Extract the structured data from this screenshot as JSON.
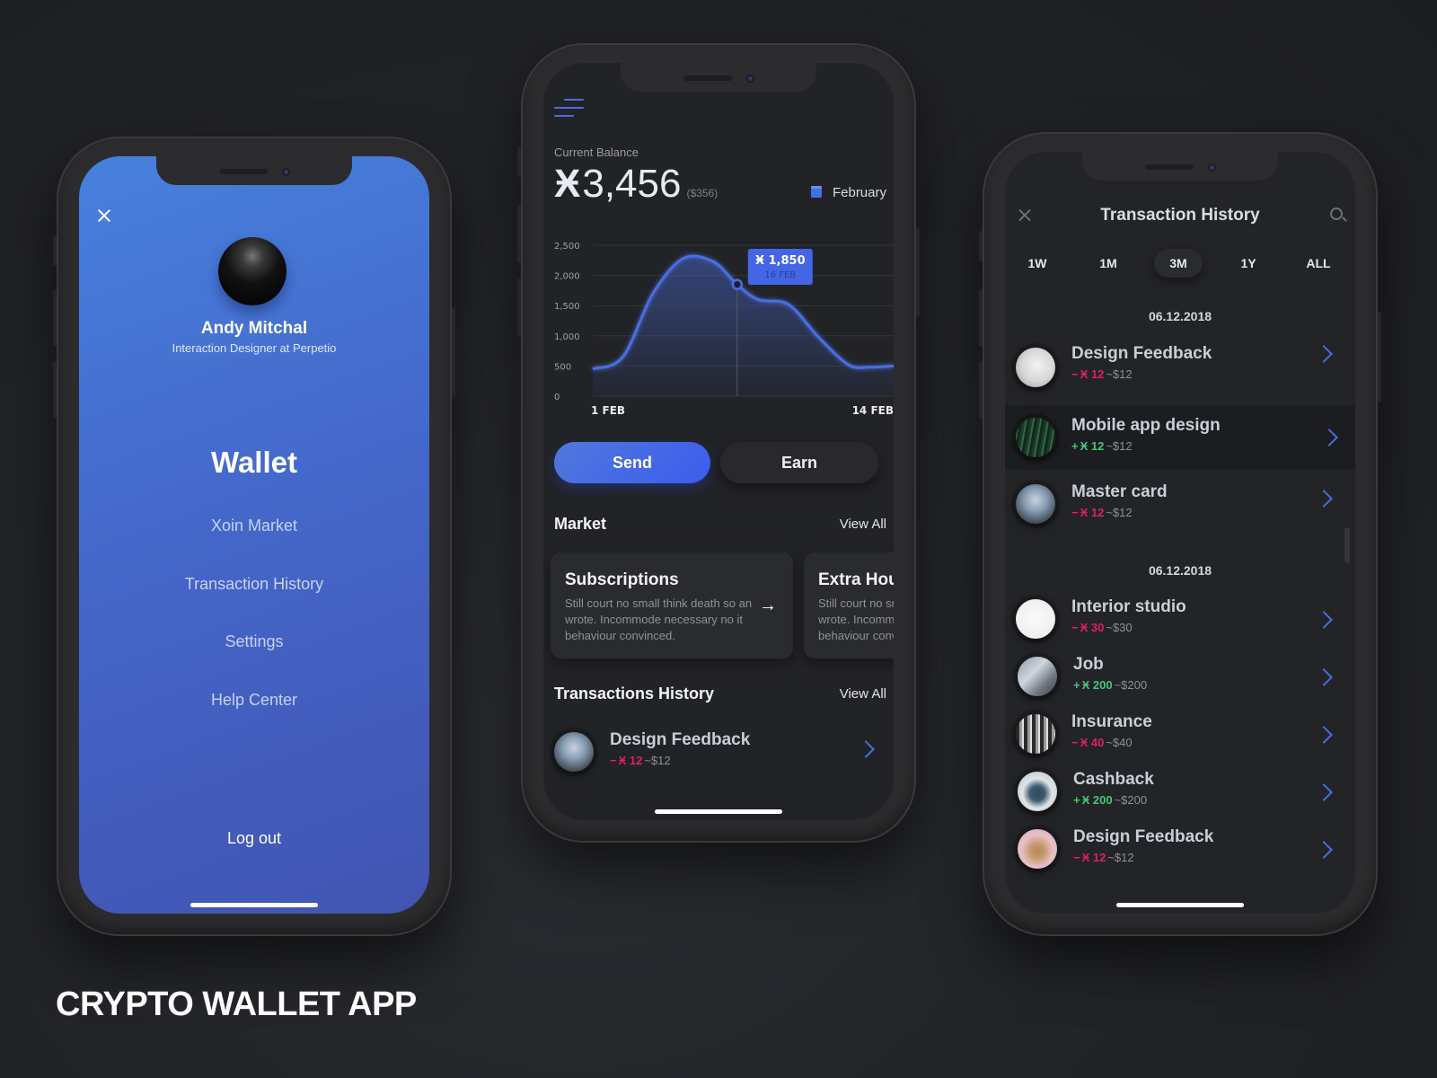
{
  "footer": {
    "title": "CRYPTO WALLET APP"
  },
  "menu_screen": {
    "user": {
      "name": "Andy Mitchal",
      "role": "Interaction Designer at Perpetio"
    },
    "title": "Wallet",
    "items": [
      {
        "label": "Xoin Market"
      },
      {
        "label": "Transaction History"
      },
      {
        "label": "Settings"
      },
      {
        "label": "Help Center"
      }
    ],
    "logout_label": "Log out"
  },
  "dashboard": {
    "balance_label": "Current Balance",
    "balance_symbol": "Ӿ",
    "balance_value": "3,456",
    "balance_usd": "($356)",
    "month": "February",
    "send_label": "Send",
    "earn_label": "Earn",
    "market": {
      "title": "Market",
      "view_all": "View All",
      "cards": [
        {
          "title": "Subscriptions",
          "desc": "Still court no small think death so an wrote. Incommode necessary no it behaviour convinced."
        },
        {
          "title": "Extra Hours",
          "desc": "Still court no small think death so an wrote. Incommode necessary no it behaviour convinced."
        }
      ]
    },
    "history": {
      "title": "Transactions History",
      "view_all": "View All",
      "items": [
        {
          "name": "Design Feedback",
          "sign": "−",
          "coin": "Ӿ 12",
          "usd": "~$12",
          "type": "neg"
        }
      ]
    }
  },
  "chart_data": {
    "type": "area",
    "title": "",
    "xlabel": "",
    "ylabel": "",
    "x_tick_labels": [
      "1 FEB",
      "14 FEB"
    ],
    "y_ticks": [
      0,
      500,
      1000,
      1500,
      2000,
      2500
    ],
    "y_tick_labels": [
      "0",
      "500",
      "1,000",
      "1,500",
      "2,000",
      "2,500"
    ],
    "ylim": [
      0,
      2500
    ],
    "grid": true,
    "series": [
      {
        "name": "Balance",
        "x": [
          0,
          0.1,
          0.2,
          0.3,
          0.4,
          0.48,
          0.55,
          0.65,
          0.75,
          0.85,
          0.92,
          1.0
        ],
        "values": [
          450,
          650,
          1700,
          2280,
          2230,
          1850,
          1600,
          1520,
          980,
          520,
          480,
          500
        ]
      }
    ],
    "tooltip": {
      "value": "Ӿ 1,850",
      "date": "16 FEB",
      "x": 0.48,
      "y": 1850
    }
  },
  "history_screen": {
    "title": "Transaction History",
    "ranges": [
      {
        "label": "1W",
        "active": false
      },
      {
        "label": "1M",
        "active": false
      },
      {
        "label": "3M",
        "active": true
      },
      {
        "label": "1Y",
        "active": false
      },
      {
        "label": "ALL",
        "active": false
      }
    ],
    "groups": [
      {
        "date": "06.12.2018",
        "items": [
          {
            "name": "Design Feedback",
            "sign": "−",
            "coin": "Ӿ 12",
            "usd": "~$12",
            "type": "neg"
          },
          {
            "name": "Mobile app design",
            "sign": "+",
            "coin": "Ӿ 12",
            "usd": "~$12",
            "type": "pos"
          },
          {
            "name": "Master card",
            "sign": "−",
            "coin": "Ӿ 12",
            "usd": "~$12",
            "type": "neg"
          }
        ]
      },
      {
        "date": "06.12.2018",
        "items": [
          {
            "name": "Interior studio",
            "sign": "−",
            "coin": "Ӿ 30",
            "usd": "~$30",
            "type": "neg"
          },
          {
            "name": "Job",
            "sign": "+",
            "coin": "Ӿ 200",
            "usd": "~$200",
            "type": "pos"
          },
          {
            "name": "Insurance",
            "sign": "−",
            "coin": "Ӿ 40",
            "usd": "~$40",
            "type": "neg"
          },
          {
            "name": "Cashback",
            "sign": "+",
            "coin": "Ӿ 200",
            "usd": "~$200",
            "type": "pos"
          },
          {
            "name": "Design Feedback",
            "sign": "−",
            "coin": "Ӿ 12",
            "usd": "~$12",
            "type": "neg"
          }
        ]
      }
    ]
  },
  "colors": {
    "accent": "#4a6ee0",
    "negative": "#e0205e",
    "positive": "#43c77a",
    "menu_gradient_start": "#4880dd",
    "menu_gradient_end": "#4254b2"
  }
}
